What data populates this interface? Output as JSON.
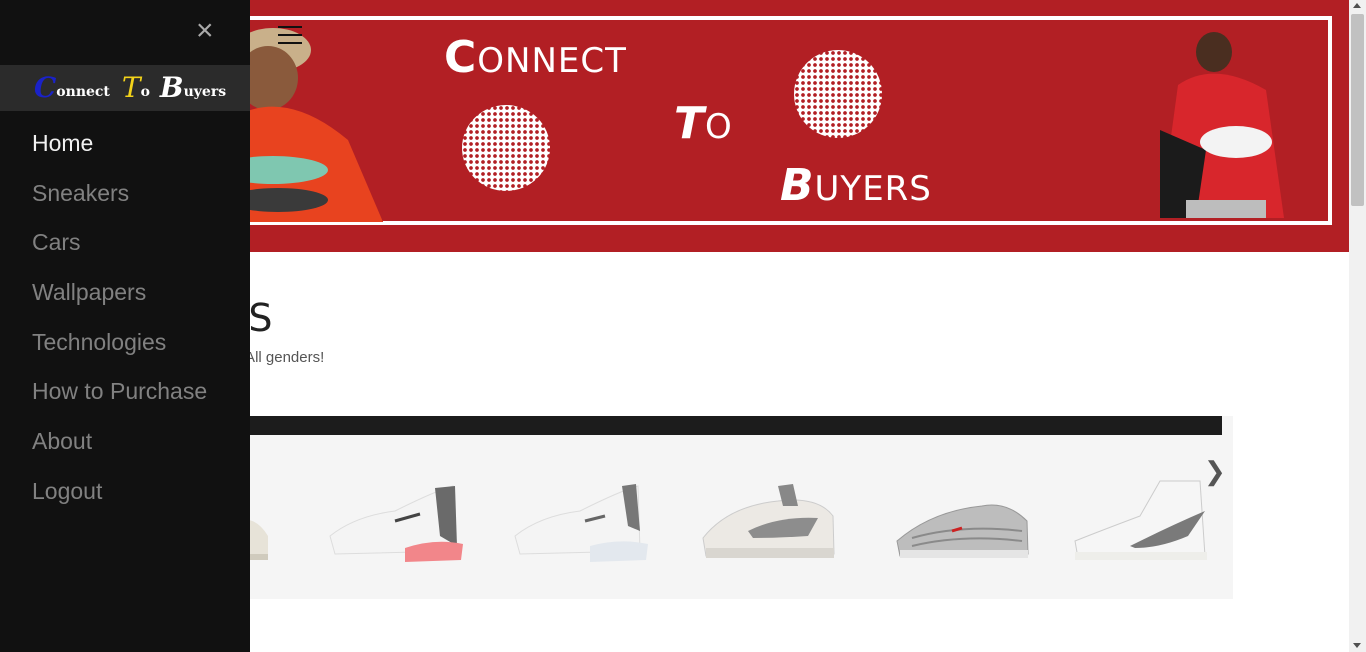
{
  "banner": {
    "word1_cap": "C",
    "word1_rest": "ONNECT",
    "word2_cap": "T",
    "word2_rest": "O",
    "word3_cap": "B",
    "word3_rest": "UYERS",
    "hamburger_icon": "menu-icon"
  },
  "main": {
    "title": "KERS",
    "subtitle": "neakers here. All genders!",
    "next_arrow": "❯"
  },
  "sidebar": {
    "close_label": "×",
    "logo": {
      "c": "C",
      "c_rest": "onnect",
      "t": "T",
      "t_rest": "o",
      "b": "B",
      "b_rest": "uyers"
    },
    "items": [
      {
        "label": "Home",
        "active": true
      },
      {
        "label": "Sneakers"
      },
      {
        "label": "Cars"
      },
      {
        "label": "Wallpapers"
      },
      {
        "label": "Technologies"
      },
      {
        "label": "How to Purchase"
      },
      {
        "label": "About"
      },
      {
        "label": "Logout"
      }
    ]
  },
  "colors": {
    "banner_red": "#b21f24",
    "sidebar_bg": "#111111",
    "logo_blue": "#1a22c8",
    "logo_yellow": "#f2d21a"
  }
}
